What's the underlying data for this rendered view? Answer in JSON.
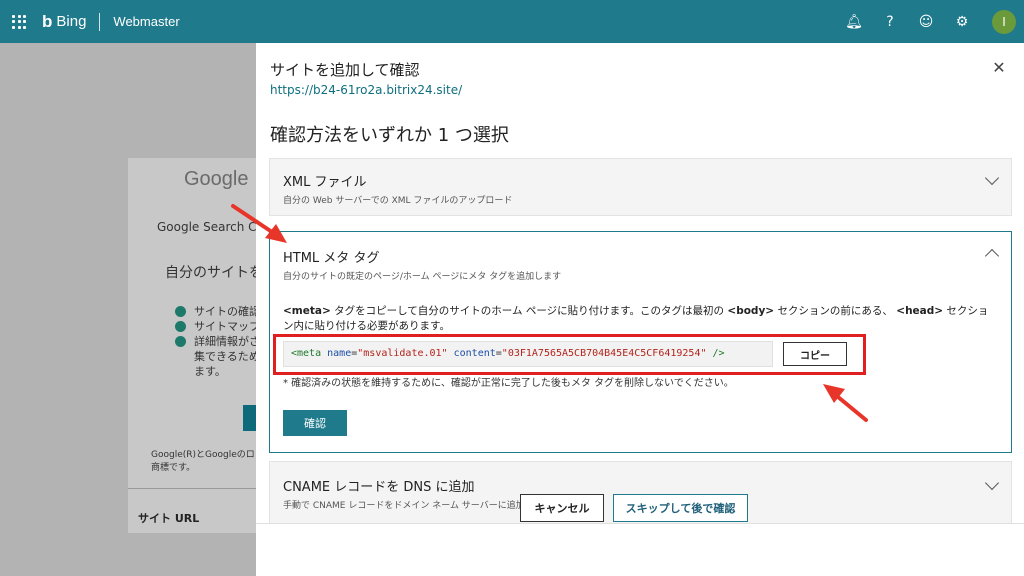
{
  "topbar": {
    "brand": "Bing",
    "app": "Webmaster",
    "avatar_initial": "I",
    "icons": [
      "bell-icon",
      "help-icon",
      "smiley-icon",
      "gear-icon"
    ]
  },
  "background": {
    "google": "Google",
    "gsc": "Google Search Co",
    "add_site": "自分のサイトを",
    "items": [
      "サイトの確認",
      "サイトマップ",
      "詳細情報がさ",
      "集できるため",
      "ます。"
    ],
    "footer1": "Google(R)とGoogleのロゴ",
    "footer2": "商標です。",
    "site_url": "サイト URL"
  },
  "panel": {
    "title": "サイトを追加して確認",
    "url": "https://b24-61ro2a.bitrix24.site/",
    "section_heading": "確認方法をいずれか 1 つ選択",
    "xml": {
      "title": "XML ファイル",
      "sub": "自分の Web サーバーでの XML ファイルのアップロード"
    },
    "html_meta": {
      "title": "HTML メタ タグ",
      "sub": "自分のサイトの既定のページ/ホーム ページにメタ タグを追加します",
      "desc_pre": "タグをコピーして自分のサイトのホーム ページに貼り付けます。このタグは最初の",
      "desc_meta": "<meta>",
      "desc_body": "<body>",
      "desc_mid": "セクションの前にある、",
      "desc_head": "<head>",
      "desc_post": "セクション内に貼り付ける必要があります。",
      "meta_tag_open": "<meta",
      "meta_attr_name": "name",
      "meta_val_name": "\"msvalidate.01\"",
      "meta_attr_content": "content",
      "meta_val_content": "\"03F1A7565A5CB704B45E4C5CF6419254\"",
      "meta_tag_close": "/>",
      "copy_label": "コピー",
      "note": "* 確認済みの状態を維持するために、確認が正常に完了した後もメタ タグを削除しないでください。",
      "verify_label": "確認"
    },
    "cname": {
      "title": "CNAME レコードを DNS に追加",
      "sub": "手動で CNAME レコードをドメイン ネーム サーバーに追加"
    },
    "cancel_label": "キャンセル",
    "skip_label": "スキップして後で確認"
  },
  "colors": {
    "topbar": "#1f7a8c",
    "accent": "#1f7a8c",
    "highlight": "#e02020",
    "arrow": "#e8352a"
  }
}
